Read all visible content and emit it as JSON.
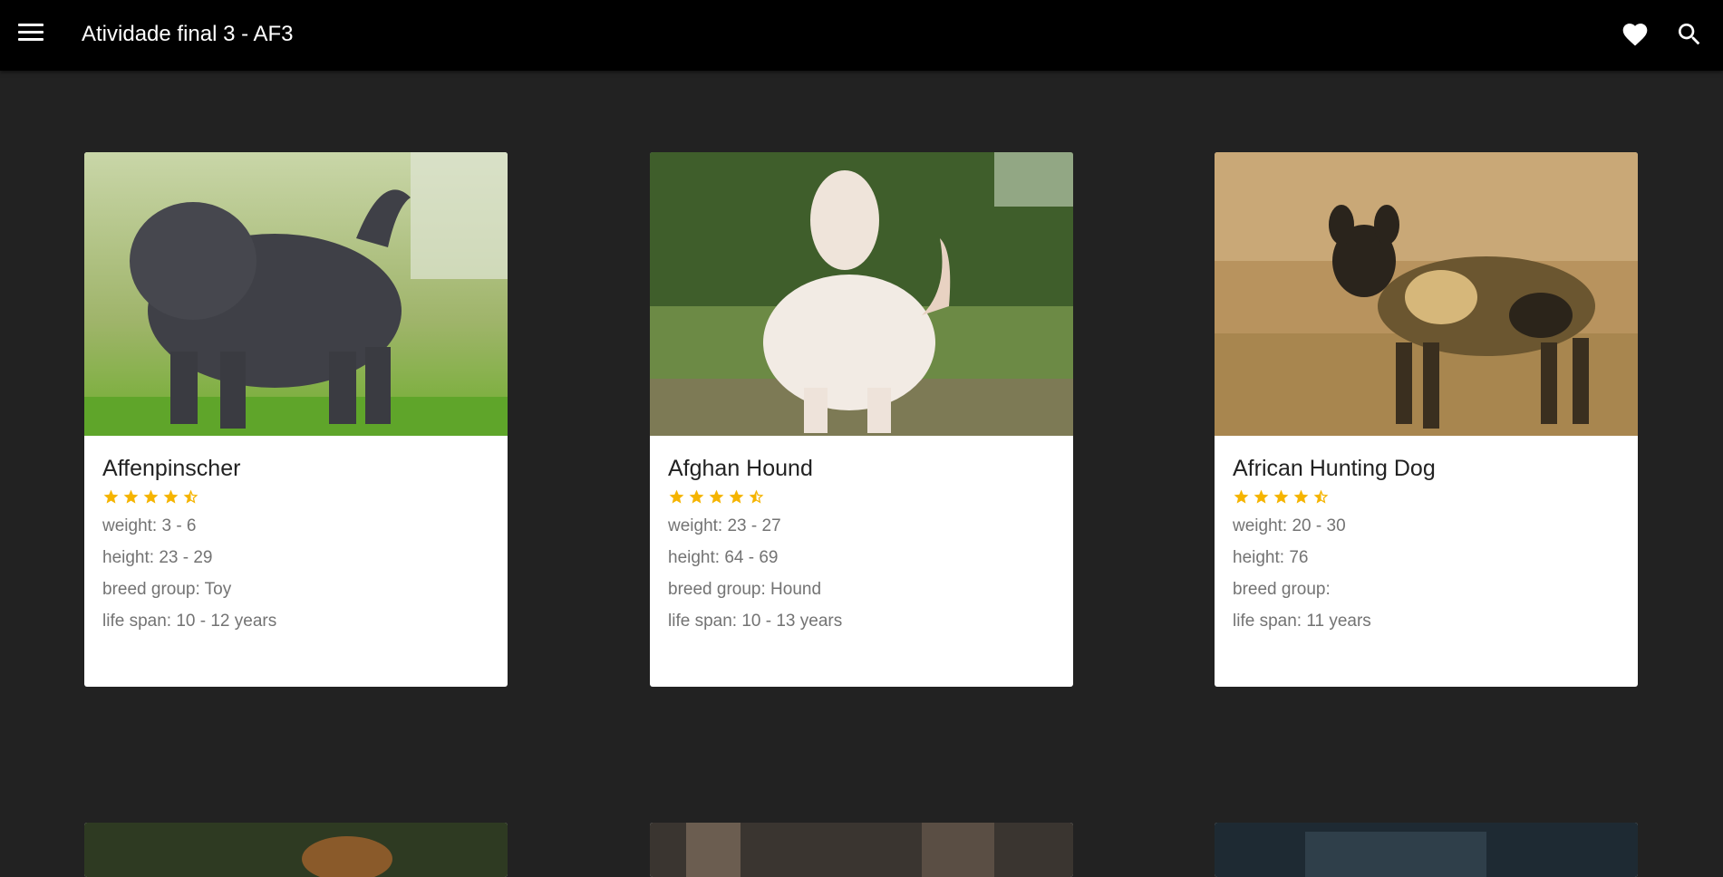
{
  "app": {
    "title": "Atividade final 3 - AF3",
    "menu_icon": "hamburger-menu-icon",
    "favorites_icon": "heart-icon",
    "search_icon": "search-icon"
  },
  "colors": {
    "topbar": "#000000",
    "background": "#222222",
    "card": "#ffffff",
    "star": "#f5b400",
    "meta_text": "#737373"
  },
  "cards": [
    {
      "name": "Affenpinscher",
      "rating": 4.5,
      "weight": "weight: 3 - 6",
      "height": "height: 23 - 29",
      "breed_group": "breed group: Toy",
      "life_span": "life span: 10 - 12 years"
    },
    {
      "name": "Afghan Hound",
      "rating": 4.5,
      "weight": "weight: 23 - 27",
      "height": "height: 64 - 69",
      "breed_group": "breed group: Hound",
      "life_span": "life span: 10 - 13 years"
    },
    {
      "name": "African Hunting Dog",
      "rating": 4.5,
      "weight": "weight: 20 - 30",
      "height": "height: 76",
      "breed_group": "breed group:",
      "life_span": "life span: 11 years"
    }
  ]
}
